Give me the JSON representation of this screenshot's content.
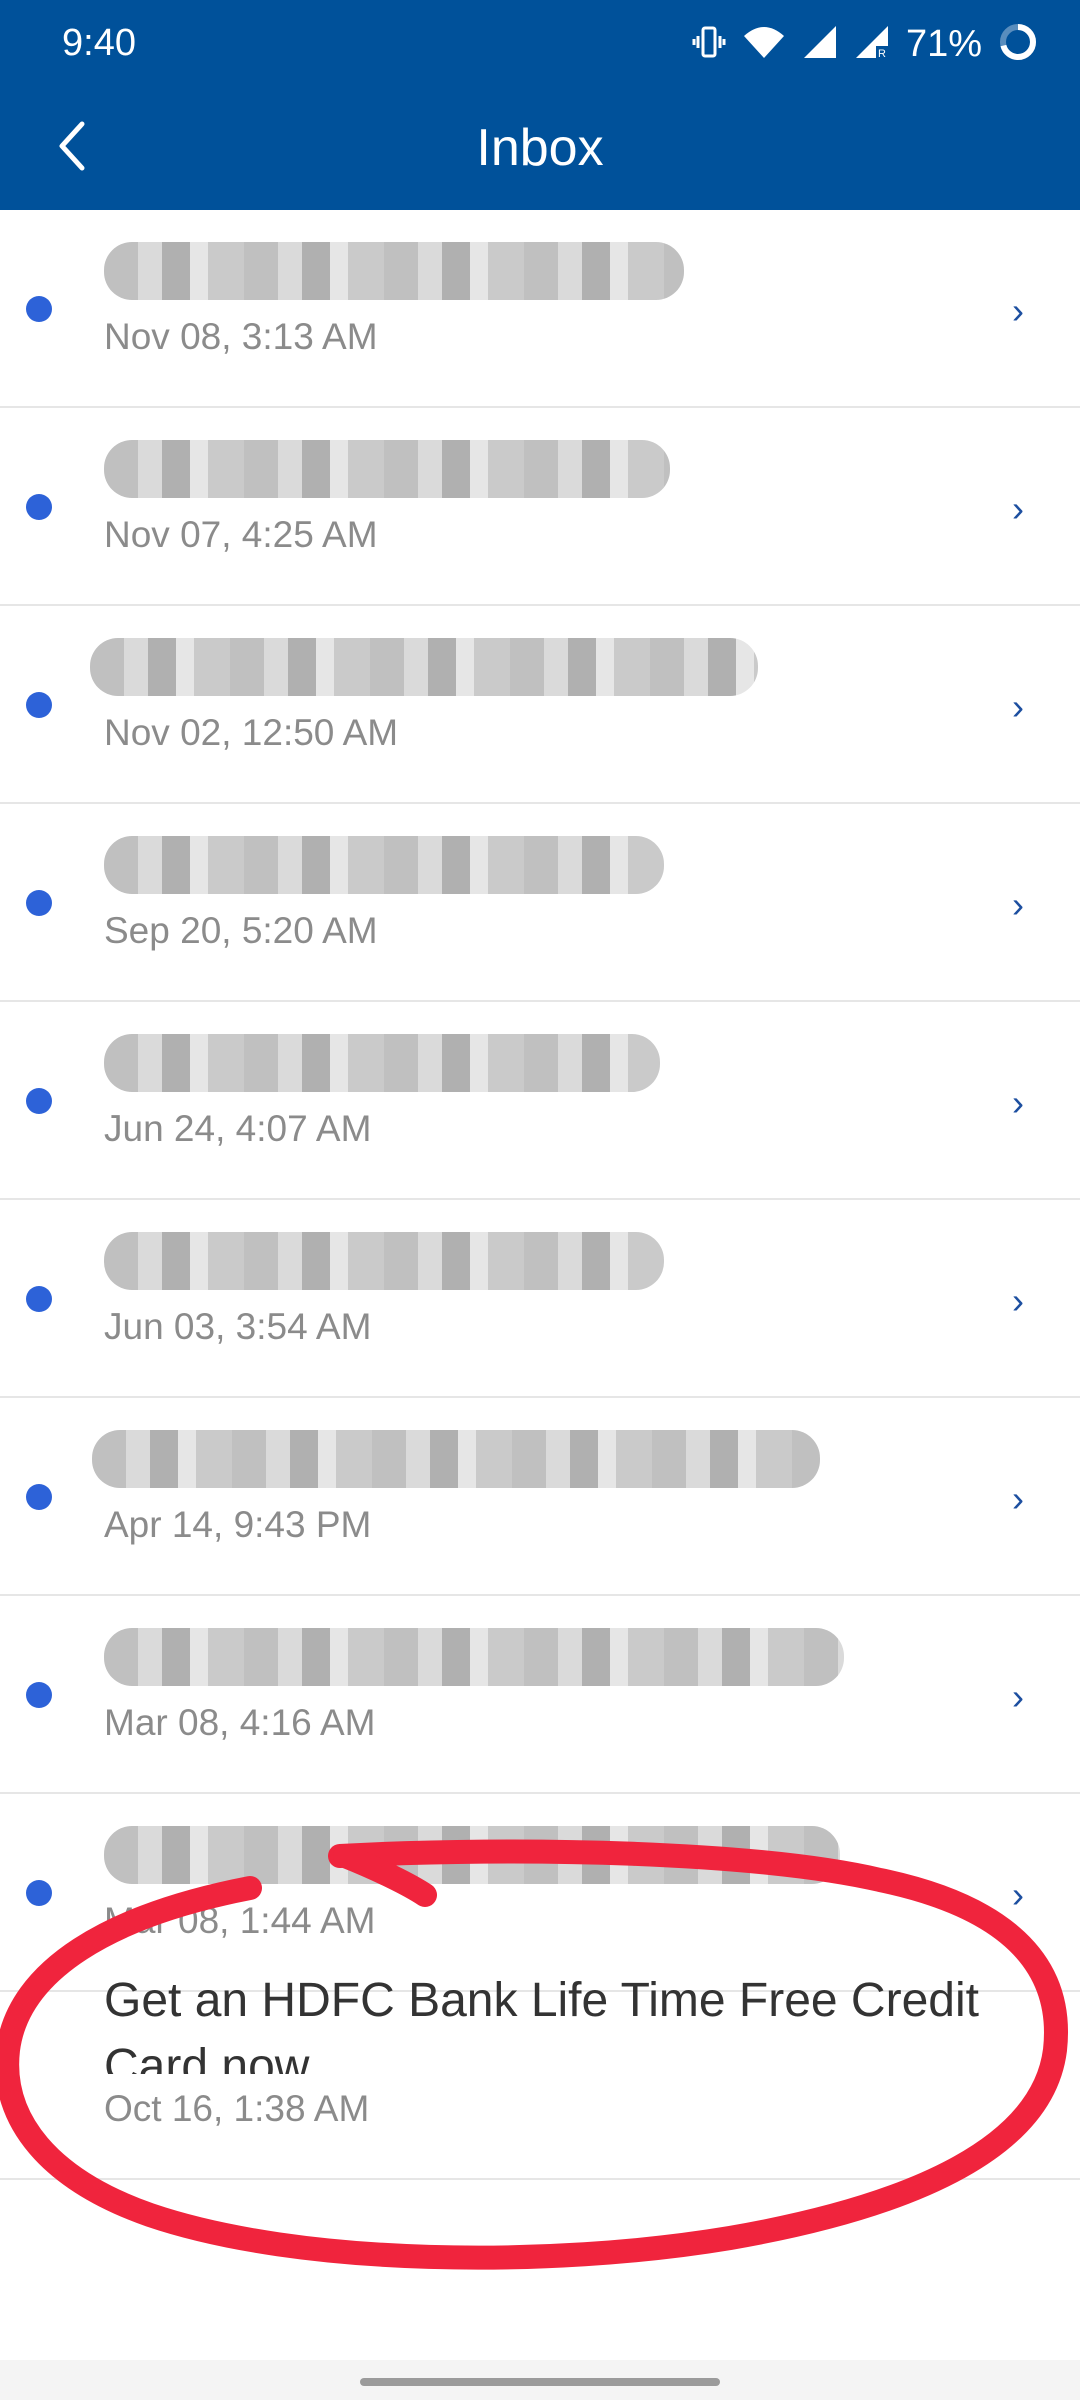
{
  "status_bar": {
    "time": "9:40",
    "battery": "71%"
  },
  "app_bar": {
    "title": "Inbox",
    "back_icon": "chevron-left-icon"
  },
  "messages": [
    {
      "date": "Nov 08, 3:13 AM",
      "unread": true
    },
    {
      "date": "Nov 07, 4:25 AM",
      "unread": true
    },
    {
      "date": "Nov 02, 12:50 AM",
      "unread": true
    },
    {
      "date": "Sep 20, 5:20 AM",
      "unread": true
    },
    {
      "date": "Jun 24, 4:07 AM",
      "unread": true
    },
    {
      "date": "Jun 03, 3:54 AM",
      "unread": true
    },
    {
      "date": "Apr 14, 9:43 PM",
      "unread": true
    },
    {
      "date": "Mar 08, 4:16 AM",
      "unread": true
    },
    {
      "date": "Mar 08, 1:44 AM",
      "unread": true
    }
  ],
  "promo_message": {
    "subject": "Get an HDFC Bank Life Time Free Credit Card now",
    "date": "Oct 16, 1:38 AM"
  },
  "colors": {
    "header": "#00519a",
    "unread_dot": "#2d62d8",
    "annotation": "#f0243d"
  }
}
